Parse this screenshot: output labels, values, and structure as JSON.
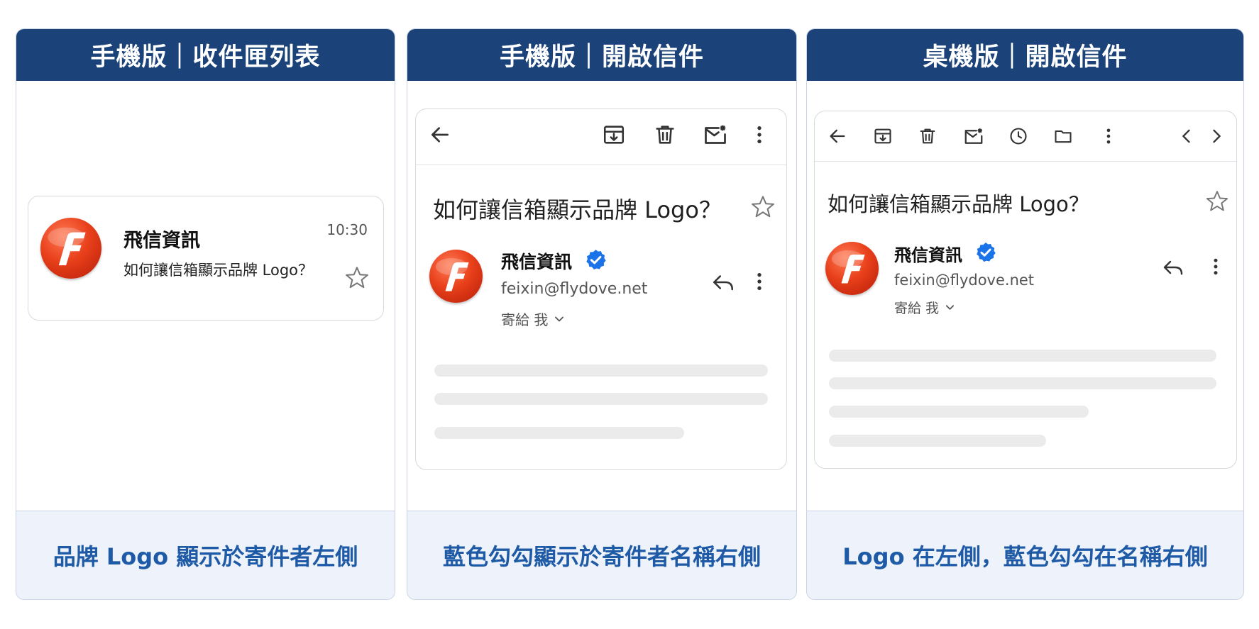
{
  "panels": [
    {
      "header": "手機版｜收件匣列表",
      "footer": "品牌 Logo 顯示於寄件者左側",
      "list_item": {
        "sender": "飛信資訊",
        "subject": "如何讓信箱顯示品牌 Logo？",
        "time": "10:30"
      }
    },
    {
      "header": "手機版｜開啟信件",
      "footer": "藍色勾勾顯示於寄件者名稱右側",
      "email": {
        "subject": "如何讓信箱顯示品牌 Logo？",
        "sender": "飛信資訊",
        "address": "feixin@flydove.net",
        "to_label": "寄給 我"
      }
    },
    {
      "header": "桌機版｜開啟信件",
      "footer": "Logo 在左側，藍色勾勾在名稱右側",
      "email": {
        "subject": "如何讓信箱顯示品牌 Logo？",
        "sender": "飛信資訊",
        "address": "feixin@flydove.net",
        "to_label": "寄給 我"
      }
    }
  ],
  "colors": {
    "header_bg": "#1b4279",
    "footer_bg": "#eef3fb",
    "footer_text": "#1e5aa6",
    "verified_badge": "#1a73e8",
    "brand_logo": "#e8401b"
  },
  "icons": {
    "mobile_toolbar": [
      "back-arrow-icon",
      "archive-icon",
      "trash-icon",
      "mark-unread-icon",
      "more-vert-icon"
    ],
    "desktop_toolbar": [
      "back-arrow-icon",
      "archive-icon",
      "trash-icon",
      "mark-unread-icon",
      "snooze-clock-icon",
      "move-folder-icon",
      "more-vert-icon",
      "chevron-left-icon",
      "chevron-right-icon"
    ]
  }
}
